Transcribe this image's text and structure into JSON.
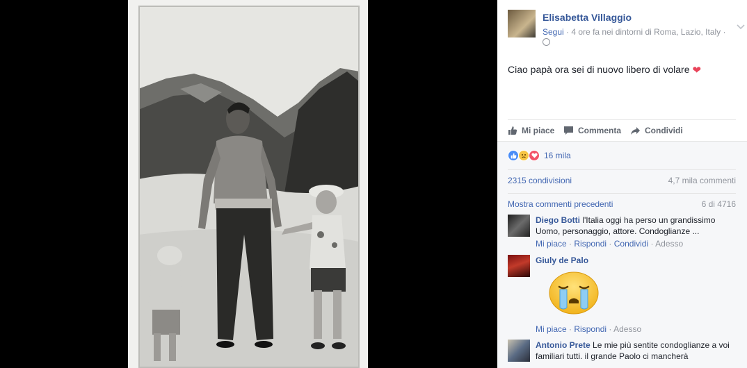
{
  "post": {
    "author": "Elisabetta Villaggio",
    "follow": "Segui",
    "meta_text": "· 4 ore fa nei dintorni di Roma, Lazio, Italy ·",
    "message": "Ciao papà ora sei di nuovo libero di volare",
    "heart_icon": "❤"
  },
  "actions": {
    "like": "Mi piace",
    "comment": "Commenta",
    "share": "Condividi"
  },
  "stats": {
    "reactions_count": "16 mila",
    "shares": "2315 condivisioni",
    "comments": "4,7 mila commenti"
  },
  "comments_nav": {
    "more": "Mostra commenti precedenti",
    "page": "6 di 4716"
  },
  "comments": [
    {
      "name": "Diego Botti",
      "text": "l'Italia oggi ha perso un grandissimo Uomo, personaggio, attore. Condoglianze ...",
      "like": "Mi piace",
      "reply": "Rispondi",
      "share": "Condividi",
      "time": "Adesso"
    },
    {
      "name": "Giuly de Palo",
      "text": "",
      "like": "Mi piace",
      "reply": "Rispondi",
      "time": "Adesso"
    },
    {
      "name": "Antonio Prete",
      "text": "Le mie più sentite condoglianze a voi familiari tutti. il grande Paolo ci mancherà"
    }
  ],
  "icons": {
    "chevron": "chevron-down-icon",
    "globe": "globe-icon",
    "like": "thumbs-up-icon",
    "comment": "speech-bubble-icon",
    "share": "share-arrow-icon"
  },
  "colors": {
    "link_blue": "#365899",
    "action_blue": "#4267b2",
    "muted": "#90949c",
    "heart": "#e9445a"
  }
}
